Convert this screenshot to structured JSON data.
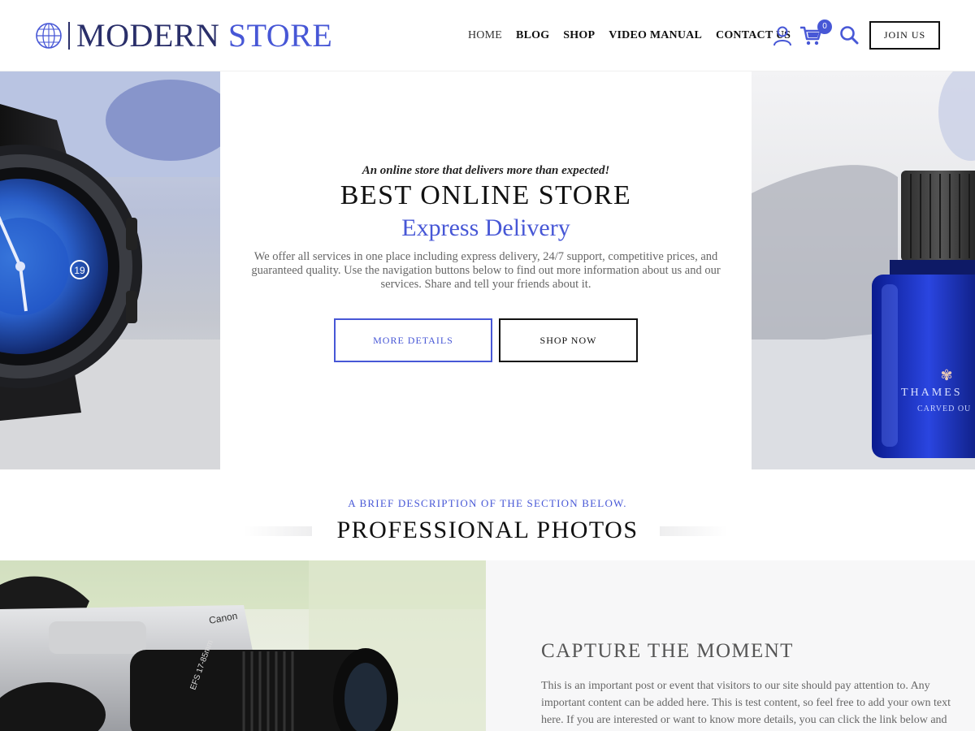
{
  "brand": {
    "name_part1": "MODERN",
    "name_part2": "STORE",
    "accent": "#4757d6",
    "dark": "#2a2f6a"
  },
  "nav": {
    "items": [
      "HOME",
      "BLOG",
      "SHOP",
      "VIDEO MANUAL",
      "CONTACT US"
    ],
    "cart_count": "0",
    "join_label": "JOIN US",
    "icons": [
      "user-icon",
      "cart-icon",
      "search-icon"
    ]
  },
  "hero": {
    "tagline": "An online store that delivers more than expected!",
    "title": "BEST ONLINE STORE",
    "subtitle": "Express Delivery",
    "description": "We offer all services in one place including express delivery, 24/7 support, competitive prices, and guaranteed quality. Use the navigation buttons below to find out more information about us and our services. Share and tell your friends about it.",
    "more_label": "MORE DETAILS",
    "shop_label": "SHOP NOW",
    "left_image": "smartwatch-image",
    "right_image": "perfume-bottle-image",
    "perfume_brand": "THAMES",
    "perfume_sub": "CARVED OU"
  },
  "section": {
    "kicker": "A BRIEF DESCRIPTION OF THE SECTION BELOW.",
    "title": "PROFESSIONAL PHOTOS"
  },
  "feature": {
    "title": "CAPTURE THE MOMENT",
    "text": "This is an important post or event that visitors to our site should pay attention to. Any important content can be added here. This is test content, so feel free to add your own text here. If you are interested or want to know more details, you can click the link below and check more details.",
    "image": "camera-image",
    "camera_label": "Canon",
    "lens_label": "EFS 17-85mm"
  }
}
